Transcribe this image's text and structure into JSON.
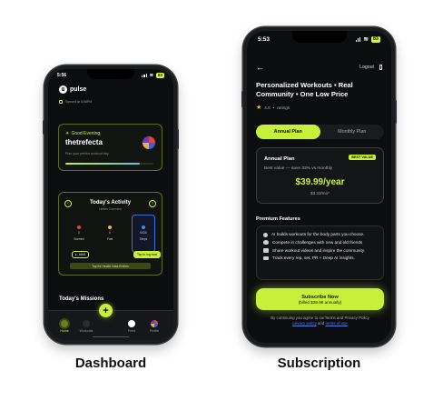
{
  "dashboard": {
    "status_time": "5:56",
    "battery": "83",
    "brand": "pulse",
    "synced_text": "Synced at 5:56PM",
    "greeting": "Good Evening,",
    "username": "thetrefecta",
    "greeting_sub": "Plan your perfect workout day",
    "greeting_progress": 0.85,
    "activity_title": "Today's Activity",
    "activity_sub": "Health Overview",
    "stats": [
      {
        "value": "0",
        "label": "Burned"
      },
      {
        "value": "0",
        "label": "Fuel"
      },
      {
        "value": "6430",
        "label": "Steps"
      }
    ],
    "steps_pill": "6665",
    "log_pill": "Tap to log food",
    "health_button": "Tap for Health Data Entries",
    "missions_title": "Today's Missions",
    "tabs": [
      {
        "label": "Home"
      },
      {
        "label": "Workouts"
      },
      {
        "label": "Feed"
      },
      {
        "label": "Profile"
      }
    ],
    "fab_label": "+",
    "caption": "Dashboard"
  },
  "subscription": {
    "status_time": "5:53",
    "battery": "83",
    "logout": "Logout",
    "title": "Personalized Workouts • Real Community • One Low Price",
    "rating_value": "4.8",
    "rating_text": "ratings",
    "toggle": [
      "Annual Plan",
      "Monthly Plan"
    ],
    "plan_name": "Annual Plan",
    "best_value": "BEST VALUE",
    "plan_save": "Best value — save 33% vs monthly",
    "plan_price": "$39.99/year",
    "plan_monthly": "$3.33/mo*",
    "features_title": "Premium Features",
    "features": [
      "AI builds workouts for the body parts you choose.",
      "Compete in challenges with new and old friends",
      "Share workout videos and inspire the community.",
      "Track every rep, set, PR + Deep AI insights."
    ],
    "subscribe_line1": "Subscribe Now",
    "subscribe_line2": "(billed $39.99 annually)",
    "legal_prefix": "By continuing you agree to ourTerms and Privacy Policy",
    "legal_link1": "privacy policy",
    "legal_and": "and",
    "legal_link2": "terms of use",
    "caption": "Subscription"
  },
  "colors": {
    "accent": "#c8f03a",
    "link": "#4d7fe6",
    "background": "#0c0d0f"
  }
}
